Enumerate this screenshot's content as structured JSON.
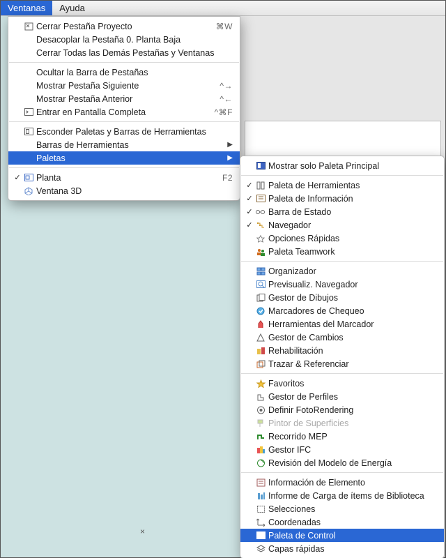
{
  "menubar": {
    "ventanas": "Ventanas",
    "ayuda": "Ayuda"
  },
  "menu": {
    "cerrarPestana": {
      "label": "Cerrar Pestaña Proyecto",
      "acc": "⌘W"
    },
    "desacoplar": {
      "label": "Desacoplar la Pestaña 0. Planta Baja"
    },
    "cerrarDemas": {
      "label": "Cerrar Todas las Demás Pestañas y Ventanas"
    },
    "ocultarBarra": {
      "label": "Ocultar la Barra de Pestañas"
    },
    "pestanaSig": {
      "label": "Mostrar Pestaña Siguiente",
      "acc": "^→"
    },
    "pestanaAnt": {
      "label": "Mostrar Pestaña Anterior",
      "acc": "^←"
    },
    "pantallaCompleta": {
      "label": "Entrar en Pantalla Completa",
      "acc": "^⌘F"
    },
    "esconderPaletas": {
      "label": "Esconder Paletas y Barras de Herramientas"
    },
    "barrasHerr": {
      "label": "Barras de Herramientas"
    },
    "paletas": {
      "label": "Paletas"
    },
    "planta": {
      "label": "Planta",
      "acc": "F2"
    },
    "ventana3d": {
      "label": "Ventana 3D"
    }
  },
  "sub": {
    "soloPrincipal": {
      "label": "Mostrar solo Paleta Principal"
    },
    "herramientas": {
      "label": "Paleta de Herramientas"
    },
    "informacion": {
      "label": "Paleta de Información"
    },
    "barraEstado": {
      "label": "Barra de Estado"
    },
    "navegador": {
      "label": "Navegador"
    },
    "opcionesRapidas": {
      "label": "Opciones Rápidas"
    },
    "teamwork": {
      "label": "Paleta Teamwork"
    },
    "organizador": {
      "label": "Organizador"
    },
    "previsNav": {
      "label": "Previsualiz. Navegador"
    },
    "gestorDibujos": {
      "label": "Gestor de Dibujos"
    },
    "marcChequeo": {
      "label": "Marcadores de Chequeo"
    },
    "herrMarcador": {
      "label": "Herramientas del Marcador"
    },
    "gestorCambios": {
      "label": "Gestor de Cambios"
    },
    "rehabilitacion": {
      "label": "Rehabilitación"
    },
    "trazarRef": {
      "label": "Trazar & Referenciar"
    },
    "favoritos": {
      "label": "Favoritos"
    },
    "gestorPerfiles": {
      "label": "Gestor de Perfiles"
    },
    "fotoRendering": {
      "label": "Definir FotoRendering"
    },
    "pintorSup": {
      "label": "Pintor de Superficies"
    },
    "recorridoMEP": {
      "label": "Recorrido MEP"
    },
    "gestorIFC": {
      "label": "Gestor IFC"
    },
    "revisionEnergia": {
      "label": "Revisión del Modelo de Energía"
    },
    "infoElemento": {
      "label": "Información de Elemento"
    },
    "informeCarga": {
      "label": "Informe de Carga de ítems de Biblioteca"
    },
    "selecciones": {
      "label": "Selecciones"
    },
    "coordenadas": {
      "label": "Coordenadas"
    },
    "paletaControl": {
      "label": "Paleta de Control"
    },
    "capasRapidas": {
      "label": "Capas rápidas"
    }
  }
}
